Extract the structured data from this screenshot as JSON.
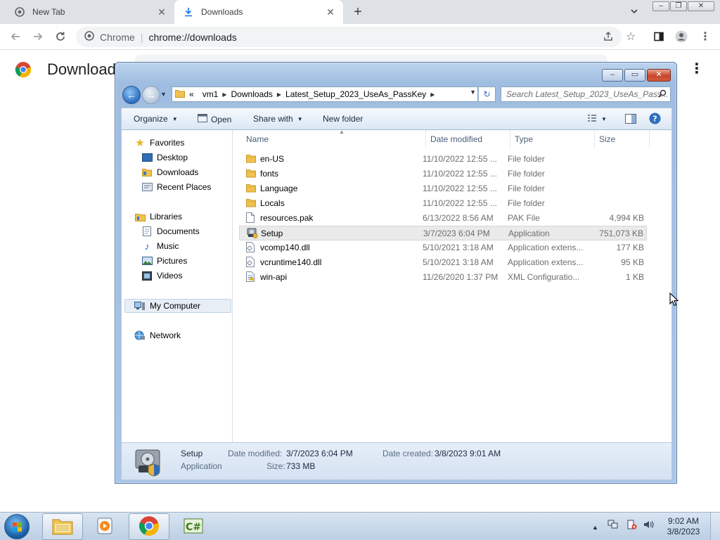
{
  "browser": {
    "tabs": [
      {
        "title": "New Tab",
        "close": "✕"
      },
      {
        "title": "Downloads",
        "close": "✕"
      }
    ],
    "new_tab": "+",
    "omnibox": {
      "site": "Chrome",
      "url": "chrome://downloads"
    },
    "page_title": "Downloads"
  },
  "explorer": {
    "breadcrumb": [
      "vm1",
      "Downloads",
      "Latest_Setup_2023_UseAs_PassKey"
    ],
    "breadcrumb_overflow": "«",
    "search_placeholder": "Search Latest_Setup_2023_UseAs_Pass...",
    "commands": {
      "organize": "Organize",
      "open": "Open",
      "share": "Share with",
      "new_folder": "New folder"
    },
    "nav": {
      "favorites": "Favorites",
      "desktop": "Desktop",
      "downloads": "Downloads",
      "recent": "Recent Places",
      "libraries": "Libraries",
      "documents": "Documents",
      "music": "Music",
      "pictures": "Pictures",
      "videos": "Videos",
      "computer": "My Computer",
      "network": "Network"
    },
    "columns": {
      "name": "Name",
      "date": "Date modified",
      "type": "Type",
      "size": "Size"
    },
    "files": [
      {
        "name": "en-US",
        "date": "11/10/2022 12:55 ...",
        "type": "File folder",
        "size": "",
        "icon": "folder-icon"
      },
      {
        "name": "fonts",
        "date": "11/10/2022 12:55 ...",
        "type": "File folder",
        "size": "",
        "icon": "folder-icon"
      },
      {
        "name": "Language",
        "date": "11/10/2022 12:55 ...",
        "type": "File folder",
        "size": "",
        "icon": "folder-icon"
      },
      {
        "name": "Locals",
        "date": "11/10/2022 12:55 ...",
        "type": "File folder",
        "size": "",
        "icon": "folder-icon"
      },
      {
        "name": "resources.pak",
        "date": "6/13/2022 8:56 AM",
        "type": "PAK File",
        "size": "4,994 KB",
        "icon": "file-icon"
      },
      {
        "name": "Setup",
        "date": "3/7/2023 6:04 PM",
        "type": "Application",
        "size": "751,073 KB",
        "icon": "installer-icon"
      },
      {
        "name": "vcomp140.dll",
        "date": "5/10/2021 3:18 AM",
        "type": "Application extens...",
        "size": "177 KB",
        "icon": "dll-icon"
      },
      {
        "name": "vcruntime140.dll",
        "date": "5/10/2021 3:18 AM",
        "type": "Application extens...",
        "size": "95 KB",
        "icon": "dll-icon"
      },
      {
        "name": "win-api",
        "date": "11/26/2020 1:37 PM",
        "type": "XML Configuratio...",
        "size": "1 KB",
        "icon": "xml-icon"
      }
    ],
    "details": {
      "name": "Setup",
      "kind": "Application",
      "modified_label": "Date modified:",
      "modified": "3/7/2023 6:04 PM",
      "created_label": "Date created:",
      "created": "3/8/2023 9:01 AM",
      "size_label": "Size:",
      "size": "733 MB"
    }
  },
  "taskbar": {
    "time": "9:02 AM",
    "date": "3/8/2023"
  }
}
